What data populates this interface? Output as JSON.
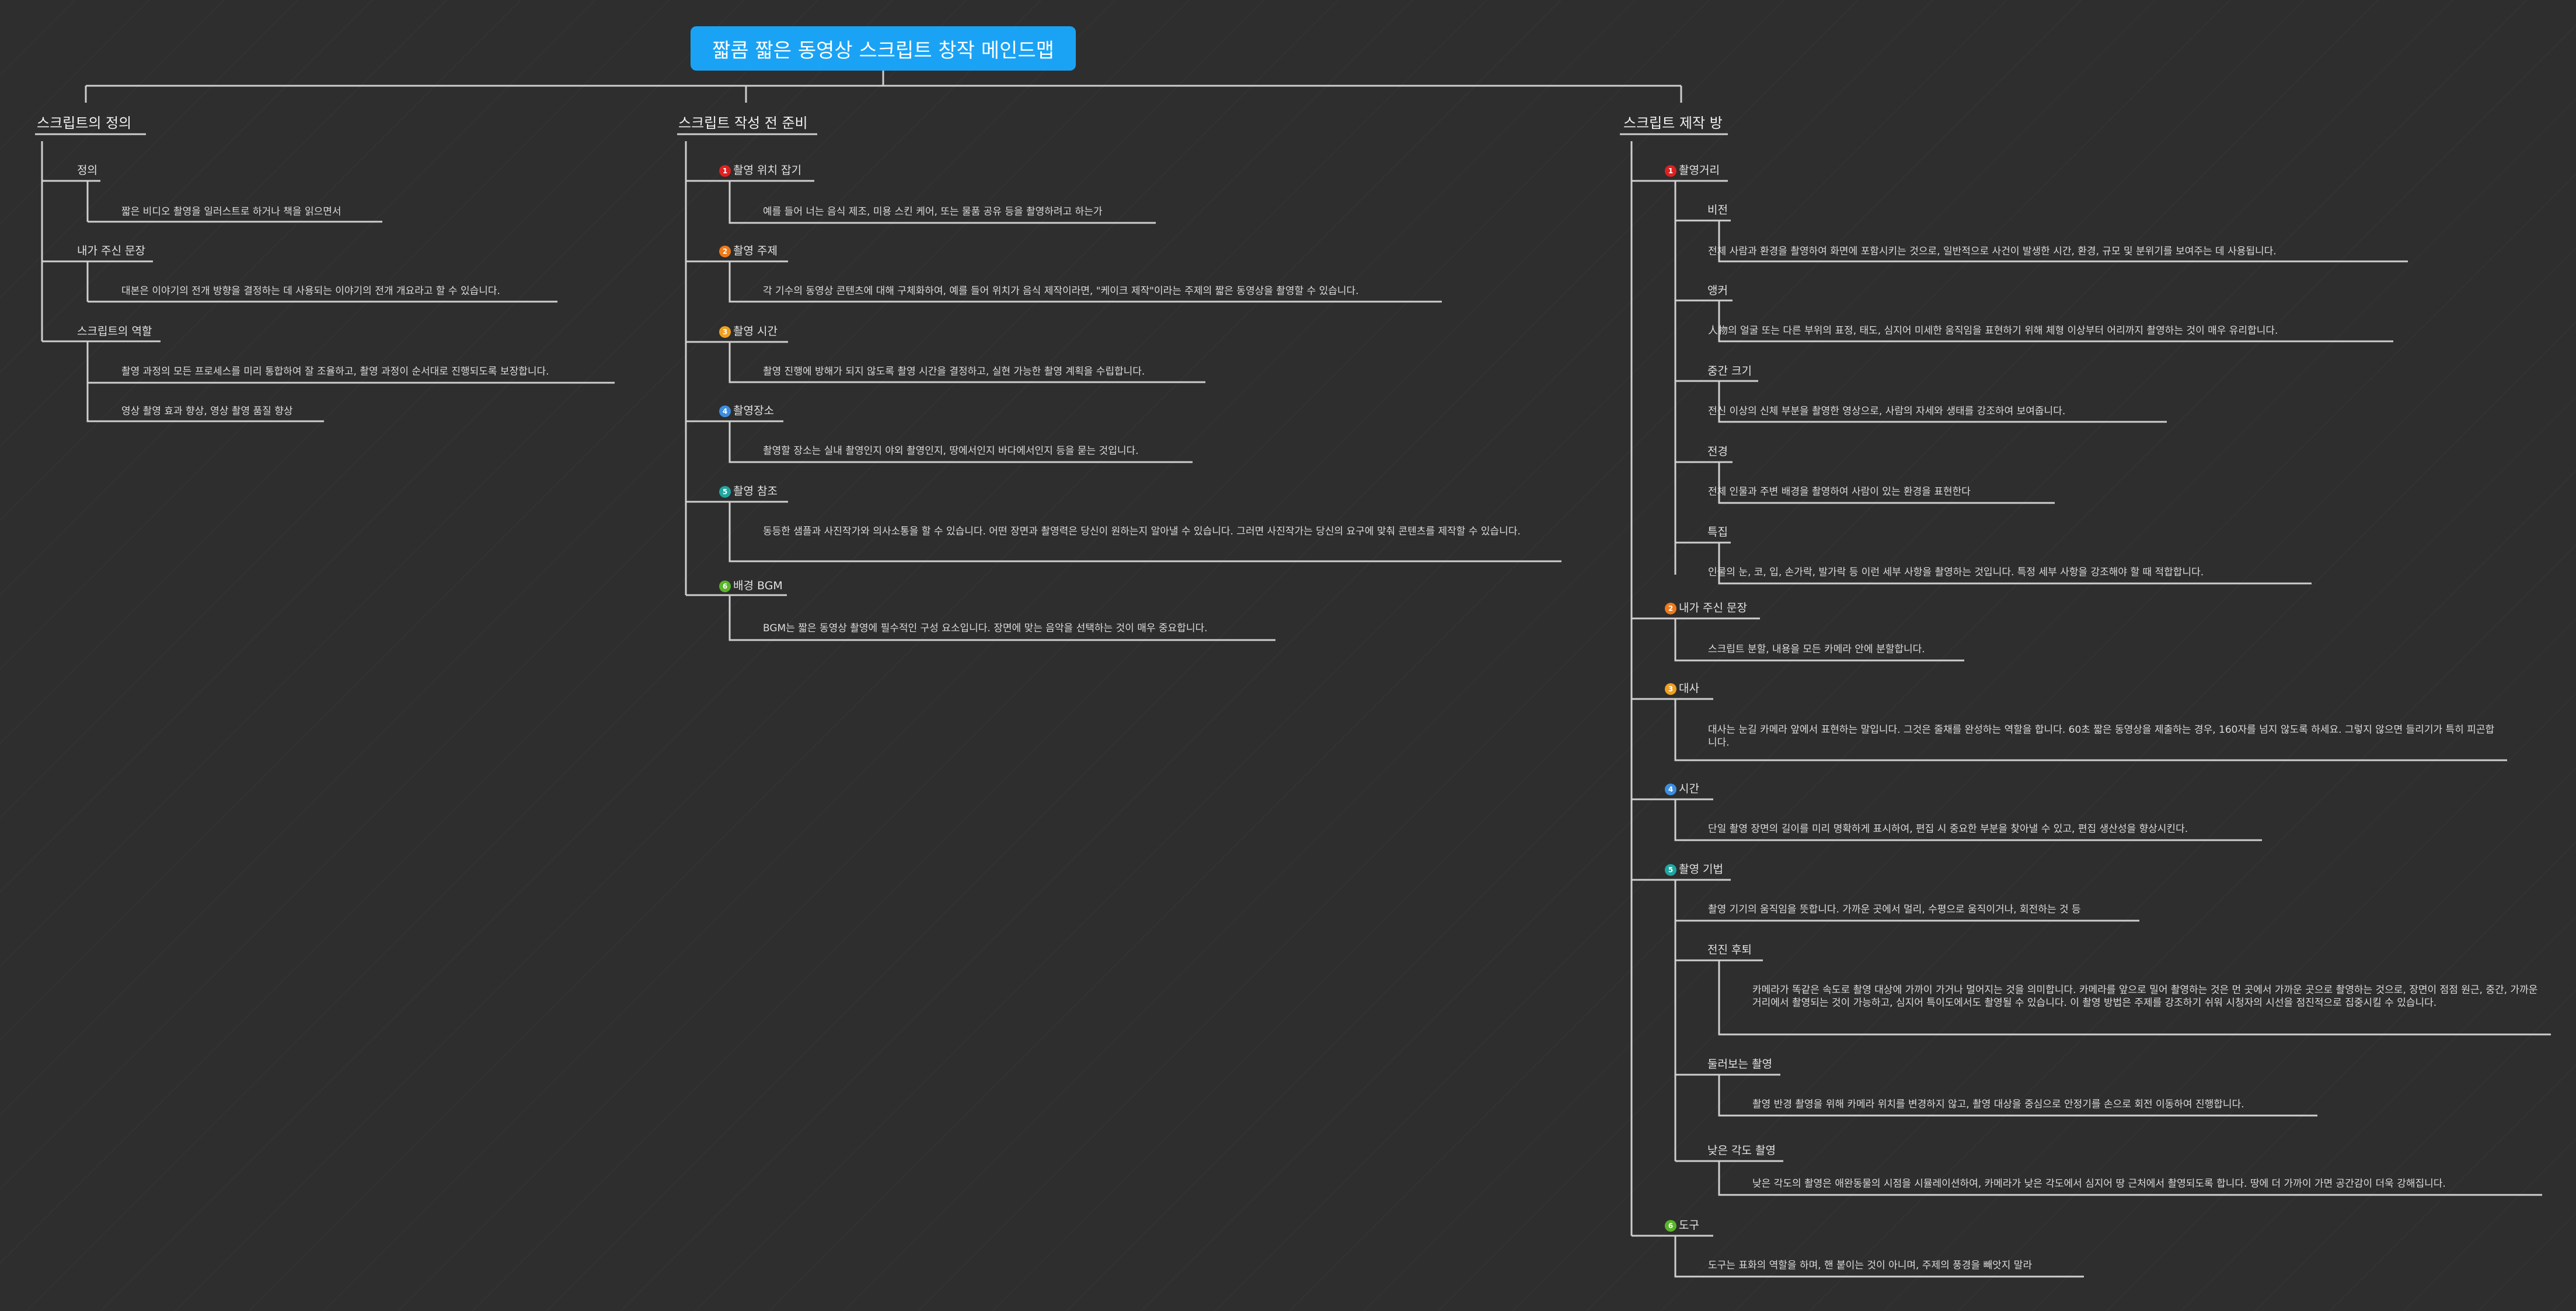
{
  "title": "짧콤 짧은 동영상 스크립트 창작 메인드맵",
  "branches": {
    "definition": {
      "label": "스크립트의 정의",
      "items": [
        {
          "label": "정의",
          "details": [
            "짧은 비디오 촬영을 일러스트로 하거나 책을 읽으면서"
          ]
        },
        {
          "label": "내가 주신 문장",
          "details": [
            "대본은 이야기의 전개 방향을 결정하는 데 사용되는 이야기의 전개 개요라고 할 수 있습니다."
          ]
        },
        {
          "label": "스크립트의 역할",
          "details": [
            "촬영 과정의 모든 프로세스를 미리 통합하여 잘 조율하고, 촬영 과정이 순서대로 진행되도록 보장합니다.",
            "영상 촬영 효과 향상, 영상 촬영 품질 향상"
          ]
        }
      ]
    },
    "preparation": {
      "label": "스크립트 작성 전 준비",
      "items": [
        {
          "marker": "1",
          "label": "촬영 위치 잡기",
          "details": [
            "예를 들어 너는 음식 제조, 미용 스킨 케어, 또는 물품 공유 등을 촬영하려고 하는가"
          ]
        },
        {
          "marker": "2",
          "label": "촬영 주제",
          "details": [
            "각 기수의 동영상 콘텐츠에 대해 구체화하여, 예를 들어 위치가 음식 제작이라면, \"케이크 제작\"이라는 주제의 짧은 동영상을 촬영할 수 있습니다."
          ]
        },
        {
          "marker": "3",
          "label": "촬영 시간",
          "details": [
            "촬영 진행에 방해가 되지 않도록 촬영 시간을 결정하고, 실현 가능한 촬영 계획을 수립합니다."
          ]
        },
        {
          "marker": "4",
          "label": "촬영장소",
          "details": [
            "촬영할 장소는 실내 촬영인지 야외 촬영인지, 땅에서인지 바다에서인지 등을 묻는 것입니다."
          ]
        },
        {
          "marker": "5",
          "label": "촬영 참조",
          "details": [
            "동등한 샘플과 사진작가와 의사소통을 할 수 있습니다. 어떤 장면과 촬영력은 당신이 원하는지 알아낼 수 있습니다. 그러면 사진작가는 당신의 요구에 맞춰 콘텐츠를 제작할 수 있습니다."
          ]
        },
        {
          "marker": "6",
          "label": "배경 BGM",
          "details": [
            "BGM는 짧은 동영상 촬영에 필수적인 구성 요소입니다. 장면에 맞는 음악을 선택하는 것이 매우 중요합니다."
          ]
        }
      ]
    },
    "production": {
      "label": "스크립트 제작 방",
      "items": [
        {
          "marker": "1",
          "label": "촬영거리",
          "subs": [
            {
              "label": "비전",
              "detail": "전체 사람과 환경을 촬영하여 화면에 포함시키는 것으로, 일반적으로 사건이 발생한 시간, 환경, 규모 및 분위기를 보여주는 데 사용됩니다."
            },
            {
              "label": "앵커",
              "detail": "人物의 얼굴 또는 다른 부위의 표정, 태도, 심지어 미세한 움직임을 표현하기 위해 체형 이상부터 어리까지 촬영하는 것이 매우 유리합니다."
            },
            {
              "label": "중간 크기",
              "detail": "전신 이상의 신체 부분을 촬영한 영상으로, 사람의 자세와 생태를 강조하여 보여줍니다."
            },
            {
              "label": "전경",
              "detail": "전체 인물과 주변 배경을 촬영하여 사람이 있는 환경을 표현한다"
            },
            {
              "label": "특집",
              "detail": "인물의 눈, 코, 입, 손가락, 발가락 등 이런 세부 사항을 촬영하는 것입니다. 특정 세부 사항을 강조해야 할 때 적합합니다."
            }
          ]
        },
        {
          "marker": "2",
          "label": "내가 주신 문장",
          "details": [
            "스크립트 분할, 내용을 모든 카메라 안에 분할합니다."
          ]
        },
        {
          "marker": "3",
          "label": "대사",
          "details": [
            "대사는 눈길 카메라 앞에서 표현하는 말입니다. 그것은 줄채를 완성하는 역할을 합니다. 60초 짧은 동영상을 제출하는 경우, 160자를 넘지 않도록 하세요. 그렇지 않으면 들리기가 특히 피곤합니다."
          ]
        },
        {
          "marker": "4",
          "label": "시간",
          "details": [
            "단일 촬영 장면의 길이를 미리 명확하게 표시하여, 편집 시 중요한 부분을 찾아낼 수 있고, 편집 생산성을 향상시킨다."
          ]
        },
        {
          "marker": "5",
          "label": "촬영 기법",
          "details": [
            "촬영 기기의 움직임을 뜻합니다. 가까운 곳에서 멀리, 수평으로 움직이거나, 회전하는 것 등"
          ],
          "subs": [
            {
              "label": "전진 후퇴",
              "detail": "카메라가 똑같은 속도로 촬영 대상에 가까이 가거나 멀어지는 것을 의미합니다. 카메라를 앞으로 밀어 촬영하는 것은 먼 곳에서 가까운 곳으로 촬영하는 것으로, 장면이 점점 원근, 중간, 가까운 거리에서 촬영되는 것이 가능하고, 심지어 특이도에서도 촬영될 수 있습니다. 이 촬영 방법은 주제를 강조하기 쉬워 시청자의 시선을 점진적으로 집중시킬 수 있습니다."
            },
            {
              "label": "둘러보는 촬영",
              "detail": "촬영 반경 촬영을 위해 카메라 위치를 변경하지 않고, 촬영 대상을 중심으로 안정기를 손으로 회전 이동하여 진행합니다."
            },
            {
              "label": "낮은 각도 촬영",
              "detail": "낮은 각도의 촬영은 애완동물의 시점을 시뮬레이션하여, 카메라가 낮은 각도에서 심지어 땅 근처에서 촬영되도록 합니다. 땅에 더 가까이 가면 공간감이 더욱 강해집니다."
            }
          ]
        },
        {
          "marker": "6",
          "label": "도구",
          "details": [
            "도구는 표화의 역할을 하며, 핸 붙이는 것이 아니며, 주제의 풍경을 빼앗지 말라"
          ]
        }
      ]
    }
  },
  "colors": {
    "background": "#2e2e2e",
    "title_box": "#1aa3f5",
    "connector": "#cfcfcf",
    "marker_1": "#e02020",
    "marker_2": "#f07a1a",
    "marker_3": "#f0a020",
    "marker_4": "#3d8ee0",
    "marker_5": "#21a6a0",
    "marker_6": "#5ab52a"
  }
}
